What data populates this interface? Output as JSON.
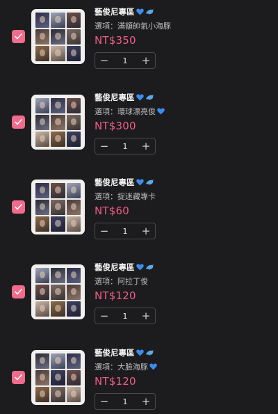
{
  "colors": {
    "background": "#1c1c1e",
    "accent": "#f06b8c",
    "price": "#f25c86"
  },
  "icons": {
    "heart": "blue-heart-icon",
    "dolphin": "dolphin-icon",
    "check": "check-icon",
    "minus": "minus-icon",
    "plus": "plus-icon"
  },
  "items": [
    {
      "title": "藝俊尼專區",
      "option": "選項：滿額帥氣小海豚",
      "price": "NT$350",
      "quantity": "1",
      "checked": true
    },
    {
      "title": "藝俊尼專區",
      "option": "選項：環球漂亮俊",
      "price": "NT$300",
      "quantity": "1",
      "checked": true,
      "option_heart": true
    },
    {
      "title": "藝俊尼專區",
      "option": "選項：捉迷藏專卡",
      "price": "NT$60",
      "quantity": "1",
      "checked": true
    },
    {
      "title": "藝俊尼專區",
      "option": "選項：阿拉丁俊",
      "price": "NT$120",
      "quantity": "1",
      "checked": true
    },
    {
      "title": "藝俊尼專區",
      "option": "選項：大臉海豚",
      "price": "NT$120",
      "quantity": "1",
      "checked": true,
      "option_heart": true
    }
  ],
  "stepper": {
    "minus_symbol": "−",
    "plus_symbol": "+"
  }
}
